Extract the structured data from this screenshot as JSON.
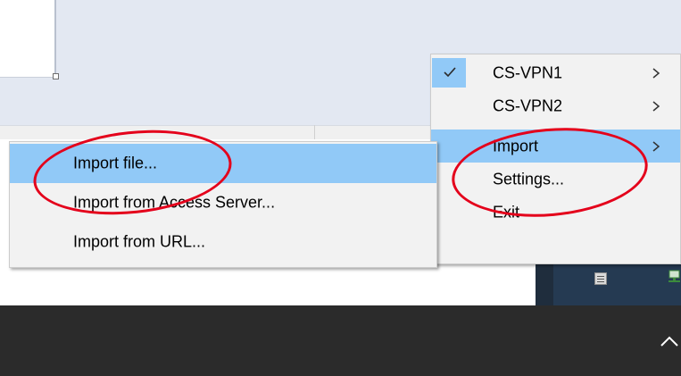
{
  "tray_menu": {
    "items": [
      {
        "label": "CS-VPN1",
        "checked": true,
        "has_submenu": true
      },
      {
        "label": "CS-VPN2",
        "checked": false,
        "has_submenu": true
      },
      {
        "label": "",
        "checked": false,
        "has_submenu": false,
        "separator_gap": true
      },
      {
        "label": "Import",
        "checked": false,
        "has_submenu": true,
        "highlighted": true
      },
      {
        "label": "Settings...",
        "checked": false,
        "has_submenu": false
      },
      {
        "label": "Exit",
        "checked": false,
        "has_submenu": false
      }
    ]
  },
  "import_submenu": {
    "items": [
      {
        "label": "Import file...",
        "highlighted": true
      },
      {
        "label": "Import from Access Server..."
      },
      {
        "label": "Import from URL..."
      }
    ]
  },
  "colors": {
    "highlight": "#91c9f7",
    "annotation": "#e4001b",
    "taskbar": "#2b2b2b"
  },
  "icons": {
    "check": "check-icon",
    "submenu_arrow": "chevron-right-icon",
    "tray_expand": "chevron-up-icon"
  }
}
